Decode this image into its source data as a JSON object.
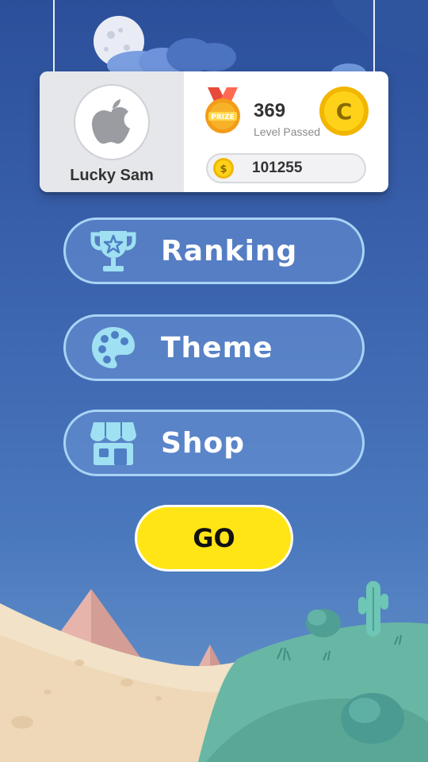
{
  "profile": {
    "name": "Lucky Sam",
    "avatar_icon": "apple-logo-icon",
    "level_count": "369",
    "level_label": "Level Passed",
    "medal_text": "PRIZE",
    "coin_letter": "C",
    "coin_symbol": "$",
    "coins": "101255"
  },
  "menu": {
    "ranking": {
      "label": "Ranking",
      "icon": "trophy-icon"
    },
    "theme": {
      "label": "Theme",
      "icon": "palette-icon"
    },
    "shop": {
      "label": "Shop",
      "icon": "shop-icon"
    }
  },
  "go": {
    "label": "GO"
  },
  "colors": {
    "sky": "#3a62ad",
    "button_fill": "#6e96d7",
    "button_border": "#a9d3f5",
    "icon": "#9fe0f2",
    "go": "#ffe516",
    "coin": "#ffd21a"
  }
}
